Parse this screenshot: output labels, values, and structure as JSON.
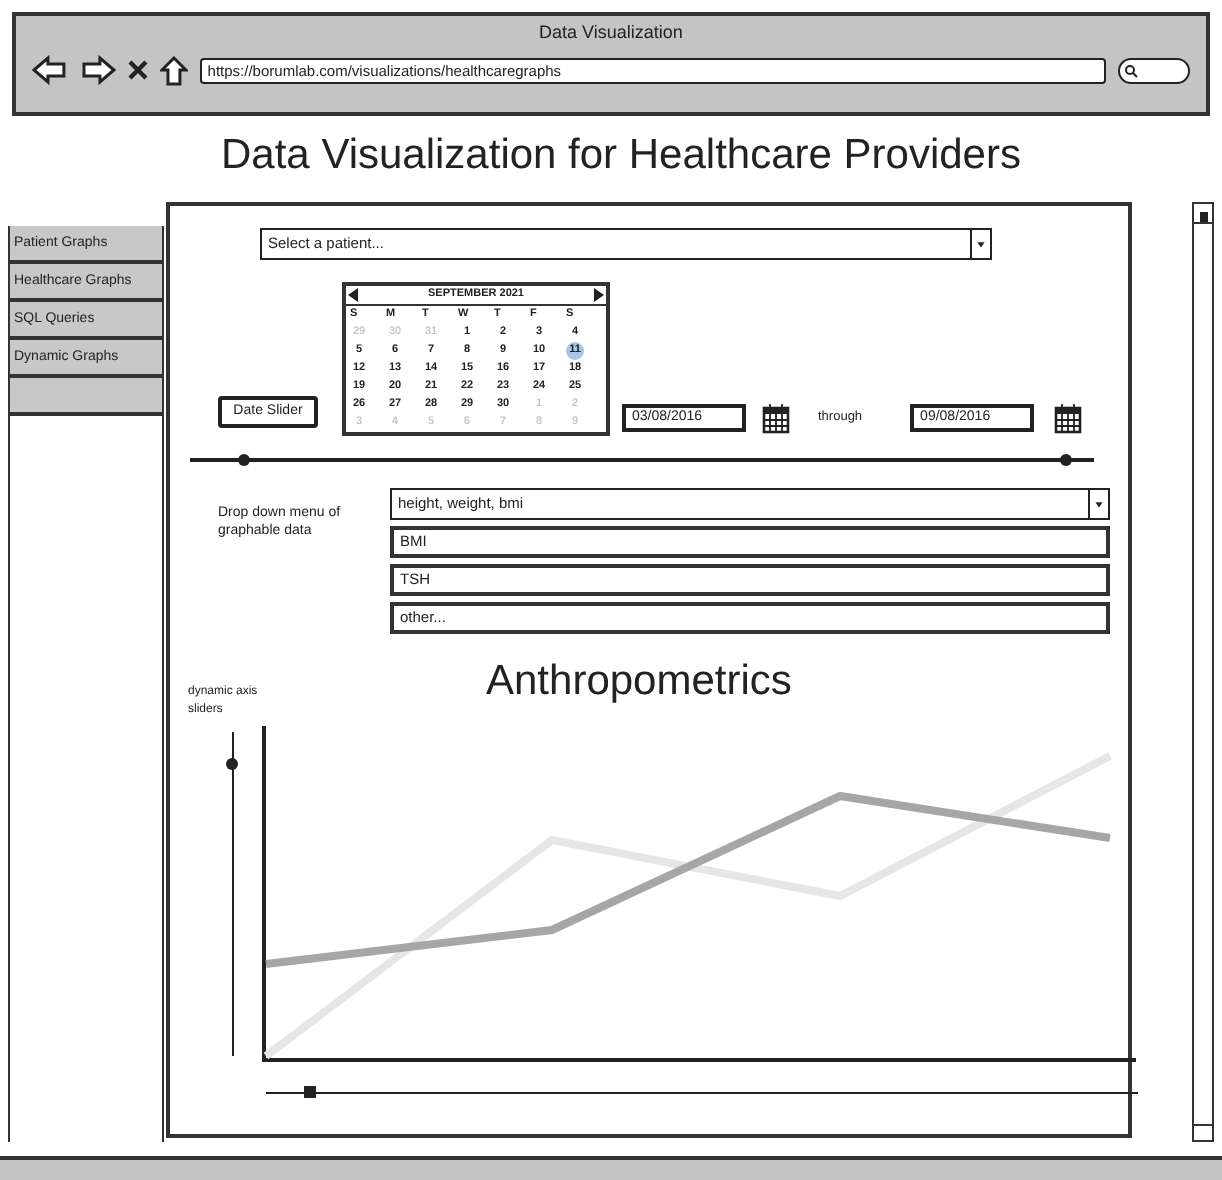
{
  "window": {
    "title": "Data Visualization"
  },
  "browser": {
    "url": "https://borumlab.com/visualizations/healthcaregraphs"
  },
  "page_title": "Data Visualization for Healthcare Providers",
  "sidebar": {
    "items": [
      {
        "label": "Patient Graphs",
        "selected": false
      },
      {
        "label": "Healthcare Graphs",
        "selected": false
      },
      {
        "label": "SQL Queries",
        "selected": false
      },
      {
        "label": "Dynamic Graphs",
        "selected": false
      }
    ]
  },
  "patient_select": {
    "value": "Select a patient..."
  },
  "date_slider_button": "Date Slider",
  "calendar": {
    "month": "SEPTEMBER 2021",
    "weekdays": [
      "S",
      "M",
      "T",
      "W",
      "T",
      "F",
      "S"
    ],
    "weeks": [
      [
        {
          "day": "29",
          "muted": true,
          "selected": false
        },
        {
          "day": "30",
          "muted": true,
          "selected": false
        },
        {
          "day": "31",
          "muted": true,
          "selected": false
        },
        {
          "day": "1",
          "muted": false,
          "selected": false
        },
        {
          "day": "2",
          "muted": false,
          "selected": false
        },
        {
          "day": "3",
          "muted": false,
          "selected": false
        },
        {
          "day": "4",
          "muted": false,
          "selected": false
        }
      ],
      [
        {
          "day": "5",
          "muted": false,
          "selected": false
        },
        {
          "day": "6",
          "muted": false,
          "selected": false
        },
        {
          "day": "7",
          "muted": false,
          "selected": false
        },
        {
          "day": "8",
          "muted": false,
          "selected": false
        },
        {
          "day": "9",
          "muted": false,
          "selected": false
        },
        {
          "day": "10",
          "muted": false,
          "selected": false
        },
        {
          "day": "11",
          "muted": false,
          "selected": true
        }
      ],
      [
        {
          "day": "12",
          "muted": false,
          "selected": false
        },
        {
          "day": "13",
          "muted": false,
          "selected": false
        },
        {
          "day": "14",
          "muted": false,
          "selected": false
        },
        {
          "day": "15",
          "muted": false,
          "selected": false
        },
        {
          "day": "16",
          "muted": false,
          "selected": false
        },
        {
          "day": "17",
          "muted": false,
          "selected": false
        },
        {
          "day": "18",
          "muted": false,
          "selected": false
        }
      ],
      [
        {
          "day": "19",
          "muted": false,
          "selected": false
        },
        {
          "day": "20",
          "muted": false,
          "selected": false
        },
        {
          "day": "21",
          "muted": false,
          "selected": false
        },
        {
          "day": "22",
          "muted": false,
          "selected": false
        },
        {
          "day": "23",
          "muted": false,
          "selected": false
        },
        {
          "day": "24",
          "muted": false,
          "selected": false
        },
        {
          "day": "25",
          "muted": false,
          "selected": false
        }
      ],
      [
        {
          "day": "26",
          "muted": false,
          "selected": false
        },
        {
          "day": "27",
          "muted": false,
          "selected": false
        },
        {
          "day": "28",
          "muted": false,
          "selected": false
        },
        {
          "day": "29",
          "muted": false,
          "selected": false
        },
        {
          "day": "30",
          "muted": false,
          "selected": false
        },
        {
          "day": "1",
          "muted": true,
          "selected": false
        },
        {
          "day": "2",
          "muted": true,
          "selected": false
        }
      ],
      [
        {
          "day": "3",
          "muted": true,
          "selected": false
        },
        {
          "day": "4",
          "muted": true,
          "selected": false
        },
        {
          "day": "5",
          "muted": true,
          "selected": false
        },
        {
          "day": "6",
          "muted": true,
          "selected": false
        },
        {
          "day": "7",
          "muted": true,
          "selected": false
        },
        {
          "day": "8",
          "muted": true,
          "selected": false
        },
        {
          "day": "9",
          "muted": true,
          "selected": false
        }
      ]
    ]
  },
  "date_from": "03/08/2016",
  "through_label": "through",
  "date_to": "09/08/2016",
  "date_range": {
    "low": {
      "level": 0.06
    },
    "high": {
      "level": 0.97
    }
  },
  "graph_data": {
    "label": "Drop down menu of graphable data",
    "value": "height, weight, bmi",
    "options": [
      "BMI",
      "TSH",
      "other..."
    ]
  },
  "chart": {
    "title": "Anthropometrics",
    "axis_label": "dynamic axis sliders",
    "y_slider": {
      "level": 0.9
    },
    "x_slider": {
      "level": 0.05
    }
  }
}
